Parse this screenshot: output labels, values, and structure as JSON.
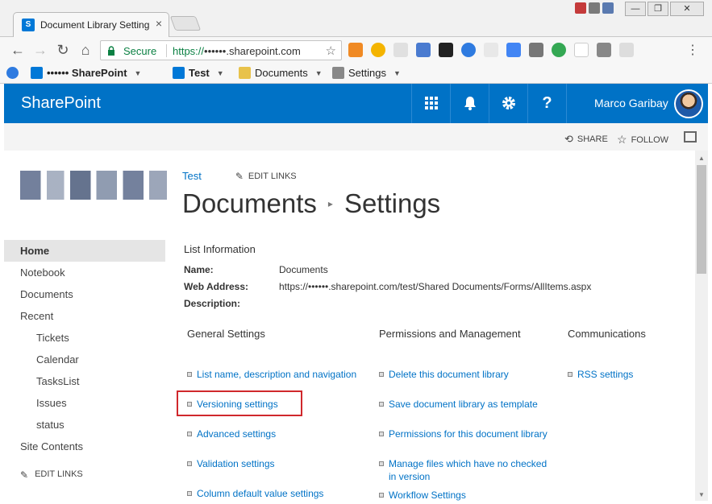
{
  "browser": {
    "tab_title": "Document Library Setting",
    "tab_close": "×",
    "secure_label": "Secure",
    "url_scheme": "https://",
    "url_host": "••••••.sharepoint.com",
    "window_buttons": [
      "—",
      "❐",
      "✕"
    ],
    "bookmarks": [
      {
        "label": "•••••• SharePoint",
        "has_menu": true
      },
      {
        "label": "Test",
        "has_menu": true
      },
      {
        "label": "Documents",
        "has_menu": true
      },
      {
        "label": "Settings",
        "has_menu": true
      }
    ]
  },
  "suitebar": {
    "brand": "SharePoint",
    "user_name": "Marco Garibay",
    "icons": [
      "app-launcher-icon",
      "bell-icon",
      "gear-icon",
      "help-icon"
    ],
    "help_glyph": "?"
  },
  "actionbar": {
    "share": "SHARE",
    "follow": "FOLLOW"
  },
  "topnav": {
    "link": "Test",
    "edit_links": "EDIT LINKS"
  },
  "page_title": {
    "part1": "Documents",
    "part2": "Settings",
    "separator": "▸"
  },
  "quicklaunch": {
    "items": [
      {
        "label": "Home",
        "selected": true
      },
      {
        "label": "Notebook"
      },
      {
        "label": "Documents"
      },
      {
        "label": "Recent"
      },
      {
        "label": "Tickets",
        "sub": true
      },
      {
        "label": "Calendar",
        "sub": true
      },
      {
        "label": "TasksList",
        "sub": true
      },
      {
        "label": "Issues",
        "sub": true
      },
      {
        "label": "status",
        "sub": true
      },
      {
        "label": "Site Contents"
      }
    ],
    "edit_links": "EDIT LINKS"
  },
  "list_info": {
    "header": "List Information",
    "name_label": "Name:",
    "name_value": "Documents",
    "web_address_label": "Web Address:",
    "web_address_value": "https://••••••.sharepoint.com/test/Shared Documents/Forms/AllItems.aspx",
    "description_label": "Description:",
    "description_value": ""
  },
  "settings": {
    "general": {
      "header": "General Settings",
      "links": [
        "List name, description and navigation",
        "Versioning settings",
        "Advanced settings",
        "Validation settings",
        "Column default value settings"
      ]
    },
    "permissions": {
      "header": "Permissions and Management",
      "links": [
        "Delete this document library",
        "Save document library as template",
        "Permissions for this document library",
        "Manage files which have no checked in version",
        "Workflow Settings"
      ]
    },
    "communications": {
      "header": "Communications",
      "links": [
        "RSS settings"
      ]
    }
  },
  "colors": {
    "suitebar": "#0072c6",
    "link": "#0072c6",
    "highlight": "#d0282c"
  }
}
